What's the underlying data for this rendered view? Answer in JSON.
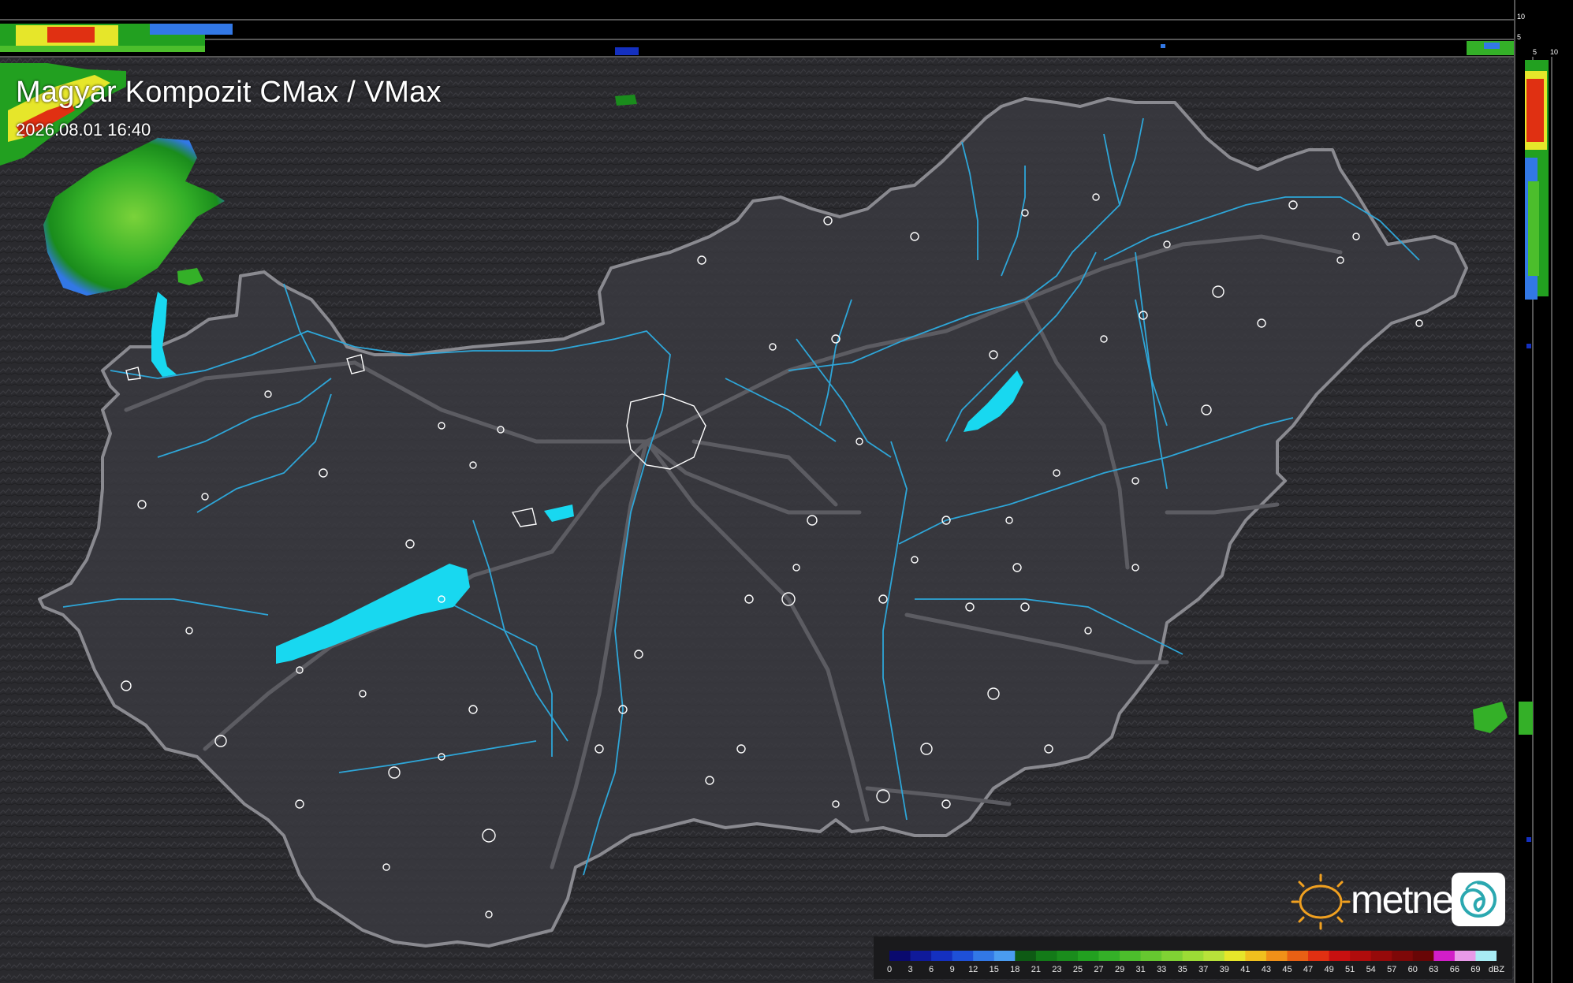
{
  "header": {
    "title": "Magyar Kompozit CMax / VMax",
    "timestamp": "2026.08.01 16:40"
  },
  "side_scale": {
    "top_labels": [
      "10",
      "5"
    ],
    "right_labels": [
      "5",
      "10"
    ]
  },
  "logo": {
    "brand": "metnet",
    "icon": "sun-icon",
    "badge_icon": "swirl-icon"
  },
  "legend": {
    "labels": [
      "0",
      "3",
      "6",
      "9",
      "12",
      "15",
      "18",
      "21",
      "23",
      "25",
      "27",
      "29",
      "31",
      "33",
      "35",
      "37",
      "39",
      "41",
      "43",
      "45",
      "47",
      "49",
      "51",
      "54",
      "57",
      "60",
      "63",
      "66",
      "69",
      "dBZ"
    ],
    "colors": [
      "#0a0a6e",
      "#0f1a9a",
      "#1430c0",
      "#1e50d8",
      "#3278e6",
      "#4a9cf0",
      "#0e5a14",
      "#137a18",
      "#1a8c1c",
      "#22a020",
      "#34b028",
      "#4cbe2c",
      "#66c830",
      "#80d234",
      "#9cdc36",
      "#b8e23a",
      "#e6e62a",
      "#f0c01e",
      "#f09018",
      "#e86014",
      "#e03012",
      "#c81010",
      "#b00c0c",
      "#960a0a",
      "#7e0808",
      "#680606",
      "#d21ec8",
      "#e89ae8",
      "#a8ecf4"
    ]
  },
  "colors": {
    "background": "#2b2b2f",
    "country_fill": "#3a3a40",
    "country_border": "#8a8a90",
    "rivers": "#2ea6d8",
    "lakes": "#18d8f0",
    "roads": "#5c5c62",
    "cities": "#ffffff"
  }
}
